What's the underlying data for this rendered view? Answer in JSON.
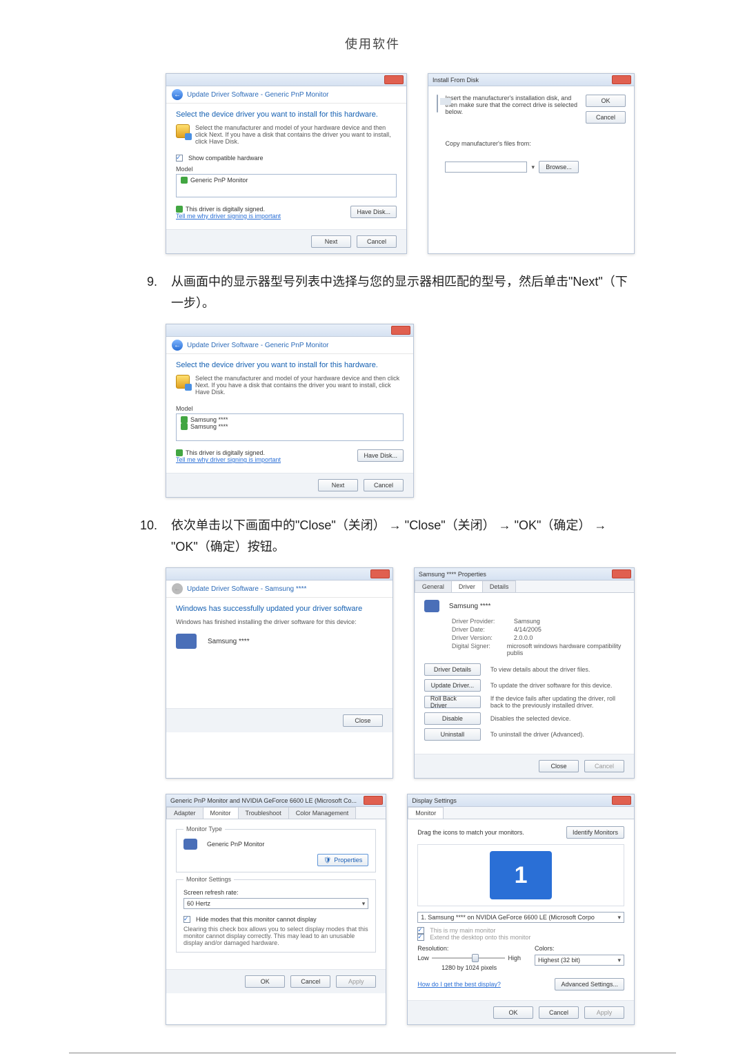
{
  "page_header": "使用软件",
  "step9": {
    "num": "9.",
    "text": "从画面中的显示器型号列表中选择与您的显示器相匹配的型号，然后单击\"Next\"（下一步）。"
  },
  "step10": {
    "num": "10.",
    "text": "依次单击以下画面中的\"Close\"（关闭） → \"Close\"（关闭） → \"OK\"（确定） → \"OK\"（确定）按钮。"
  },
  "wizard_common": {
    "breadcrumb_a": "Update Driver Software - Generic PnP Monitor",
    "section_head": "Select the device driver you want to install for this hardware.",
    "hint": "Select the manufacturer and model of your hardware device and then click Next. If you have a disk that contains the driver you want to install, click Have Disk.",
    "show_compatible": "Show compatible hardware",
    "model_lbl": "Model",
    "signed": "This driver is digitally signed.",
    "signed_link": "Tell me why driver signing is important",
    "have_disk_btn": "Have Disk...",
    "next_btn": "Next",
    "cancel_btn": "Cancel"
  },
  "wizard1": {
    "list_item": "Generic PnP Monitor"
  },
  "install_disk": {
    "title": "Install From Disk",
    "msg": "Insert the manufacturer's installation disk, and then make sure that the correct drive is selected below.",
    "copy_lbl": "Copy manufacturer's files from:",
    "ok": "OK",
    "cancel": "Cancel",
    "browse": "Browse..."
  },
  "wizard2": {
    "item1": "Samsung ****",
    "item2": "Samsung ****"
  },
  "wizard3": {
    "breadcrumb": "Update Driver Software - Samsung ****",
    "success": "Windows has successfully updated your driver software",
    "finished": "Windows has finished installing the driver software for this device:",
    "device": "Samsung ****",
    "close": "Close"
  },
  "props": {
    "title": "Samsung **** Properties",
    "tab_general": "General",
    "tab_driver": "Driver",
    "tab_details": "Details",
    "device": "Samsung ****",
    "provider_k": "Driver Provider:",
    "provider_v": "Samsung",
    "date_k": "Driver Date:",
    "date_v": "4/14/2005",
    "ver_k": "Driver Version:",
    "ver_v": "2.0.0.0",
    "signer_k": "Digital Signer:",
    "signer_v": "microsoft windows hardware compatibility publis",
    "b_details": "Driver Details",
    "b_details_d": "To view details about the driver files.",
    "b_update": "Update Driver...",
    "b_update_d": "To update the driver software for this device.",
    "b_rollback": "Roll Back Driver",
    "b_rollback_d": "If the device fails after updating the driver, roll back to the previously installed driver.",
    "b_disable": "Disable",
    "b_disable_d": "Disables the selected device.",
    "b_uninstall": "Uninstall",
    "b_uninstall_d": "To uninstall the driver (Advanced).",
    "close": "Close",
    "cancel": "Cancel"
  },
  "monitor_tab": {
    "title": "Generic PnP Monitor and NVIDIA GeForce 6600 LE (Microsoft Co...",
    "t_adapter": "Adapter",
    "t_monitor": "Monitor",
    "t_trouble": "Troubleshoot",
    "t_color": "Color Management",
    "type_lbl": "Monitor Type",
    "type_val": "Generic PnP Monitor",
    "props_btn": "Properties",
    "settings_lbl": "Monitor Settings",
    "refresh_lbl": "Screen refresh rate:",
    "refresh_val": "60 Hertz",
    "hide_chk": "Hide modes that this monitor cannot display",
    "hide_desc": "Clearing this check box allows you to select display modes that this monitor cannot display correctly. This may lead to an unusable display and/or damaged hardware.",
    "ok": "OK",
    "cancel": "Cancel",
    "apply": "Apply"
  },
  "disp": {
    "title": "Display Settings",
    "tab": "Monitor",
    "drag": "Drag the icons to match your monitors.",
    "identify": "Identify Monitors",
    "sel": "1. Samsung **** on NVIDIA GeForce 6600 LE (Microsoft Corpo",
    "main_chk": "This is my main monitor",
    "ext_chk": "Extend the desktop onto this monitor",
    "res_lbl": "Resolution:",
    "low": "Low",
    "high": "High",
    "res_val": "1280 by 1024 pixels",
    "col_lbl": "Colors:",
    "col_val": "Highest (32 bit)",
    "best_link": "How do I get the best display?",
    "adv": "Advanced Settings...",
    "ok": "OK",
    "cancel": "Cancel",
    "apply": "Apply"
  }
}
